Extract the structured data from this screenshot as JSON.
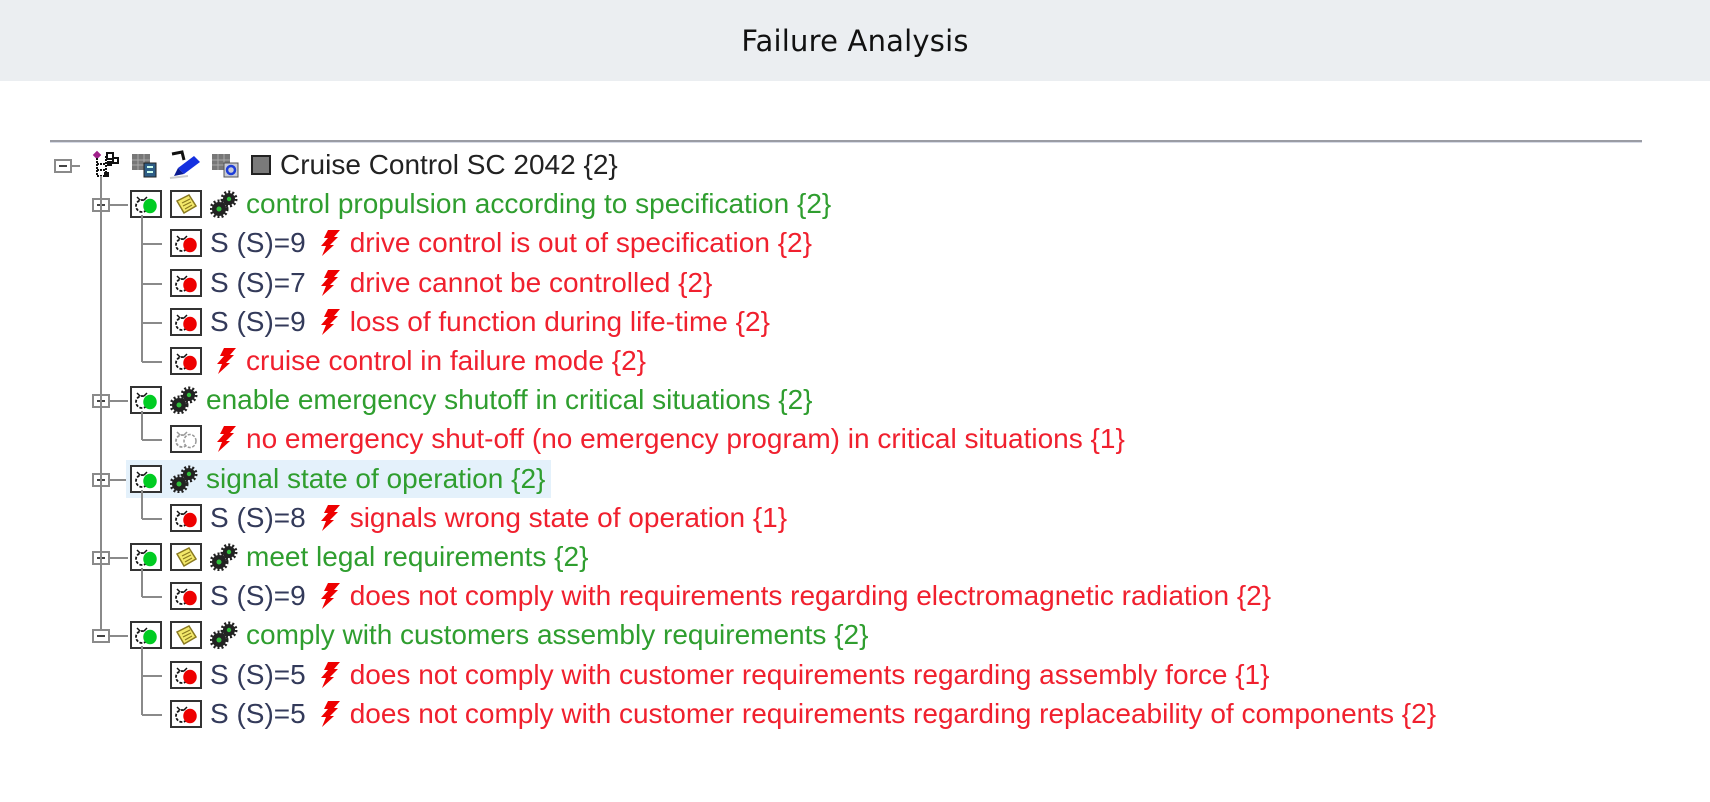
{
  "header": {
    "title": "Failure Analysis"
  },
  "colors": {
    "function_text": "#2f9e2f",
    "failure_text": "#f0202e",
    "root_text": "#222222",
    "selection_bg": "#e4f1fb",
    "header_bg": "#ebeef1"
  },
  "tree": {
    "root": {
      "label": "Cruise Control SC 2042 {2}",
      "icons": [
        "structure-tree-icon",
        "form-sheet-icon",
        "pin-marker-icon",
        "sheet-refresh-icon",
        "gray-square-icon"
      ]
    },
    "functions": [
      {
        "label": "control propulsion according to specification {2}",
        "has_note": true,
        "failures": [
          {
            "severity": "S (S)=9",
            "label": "drive control is out of specification {2}",
            "status": "red"
          },
          {
            "severity": "S (S)=7",
            "label": "drive cannot be controlled {2}",
            "status": "red"
          },
          {
            "severity": "S (S)=9",
            "label": "loss of function during life-time {2}",
            "status": "red"
          },
          {
            "severity": "",
            "label": "cruise control in failure mode {2}",
            "status": "red"
          }
        ]
      },
      {
        "label": "enable emergency shutoff in critical situations {2}",
        "has_note": false,
        "failures": [
          {
            "severity": "",
            "label": "no emergency shut-off (no emergency program) in critical situations {1}",
            "status": "none"
          }
        ]
      },
      {
        "label": "signal state of operation {2}",
        "has_note": false,
        "selected": true,
        "failures": [
          {
            "severity": "S (S)=8",
            "label": "signals wrong state of operation {1}",
            "status": "red"
          }
        ]
      },
      {
        "label": "meet legal requirements {2}",
        "has_note": true,
        "failures": [
          {
            "severity": "S (S)=9",
            "label": "does not comply with requirements regarding electromagnetic radiation {2}",
            "status": "red"
          }
        ]
      },
      {
        "label": "comply with customers assembly requirements {2}",
        "has_note": true,
        "failures": [
          {
            "severity": "S (S)=5",
            "label": "does not comply with customer requirements regarding assembly force {1}",
            "status": "red"
          },
          {
            "severity": "S (S)=5",
            "label": "does not comply with customer requirements regarding replaceability of components {2}",
            "status": "red"
          }
        ]
      }
    ]
  }
}
